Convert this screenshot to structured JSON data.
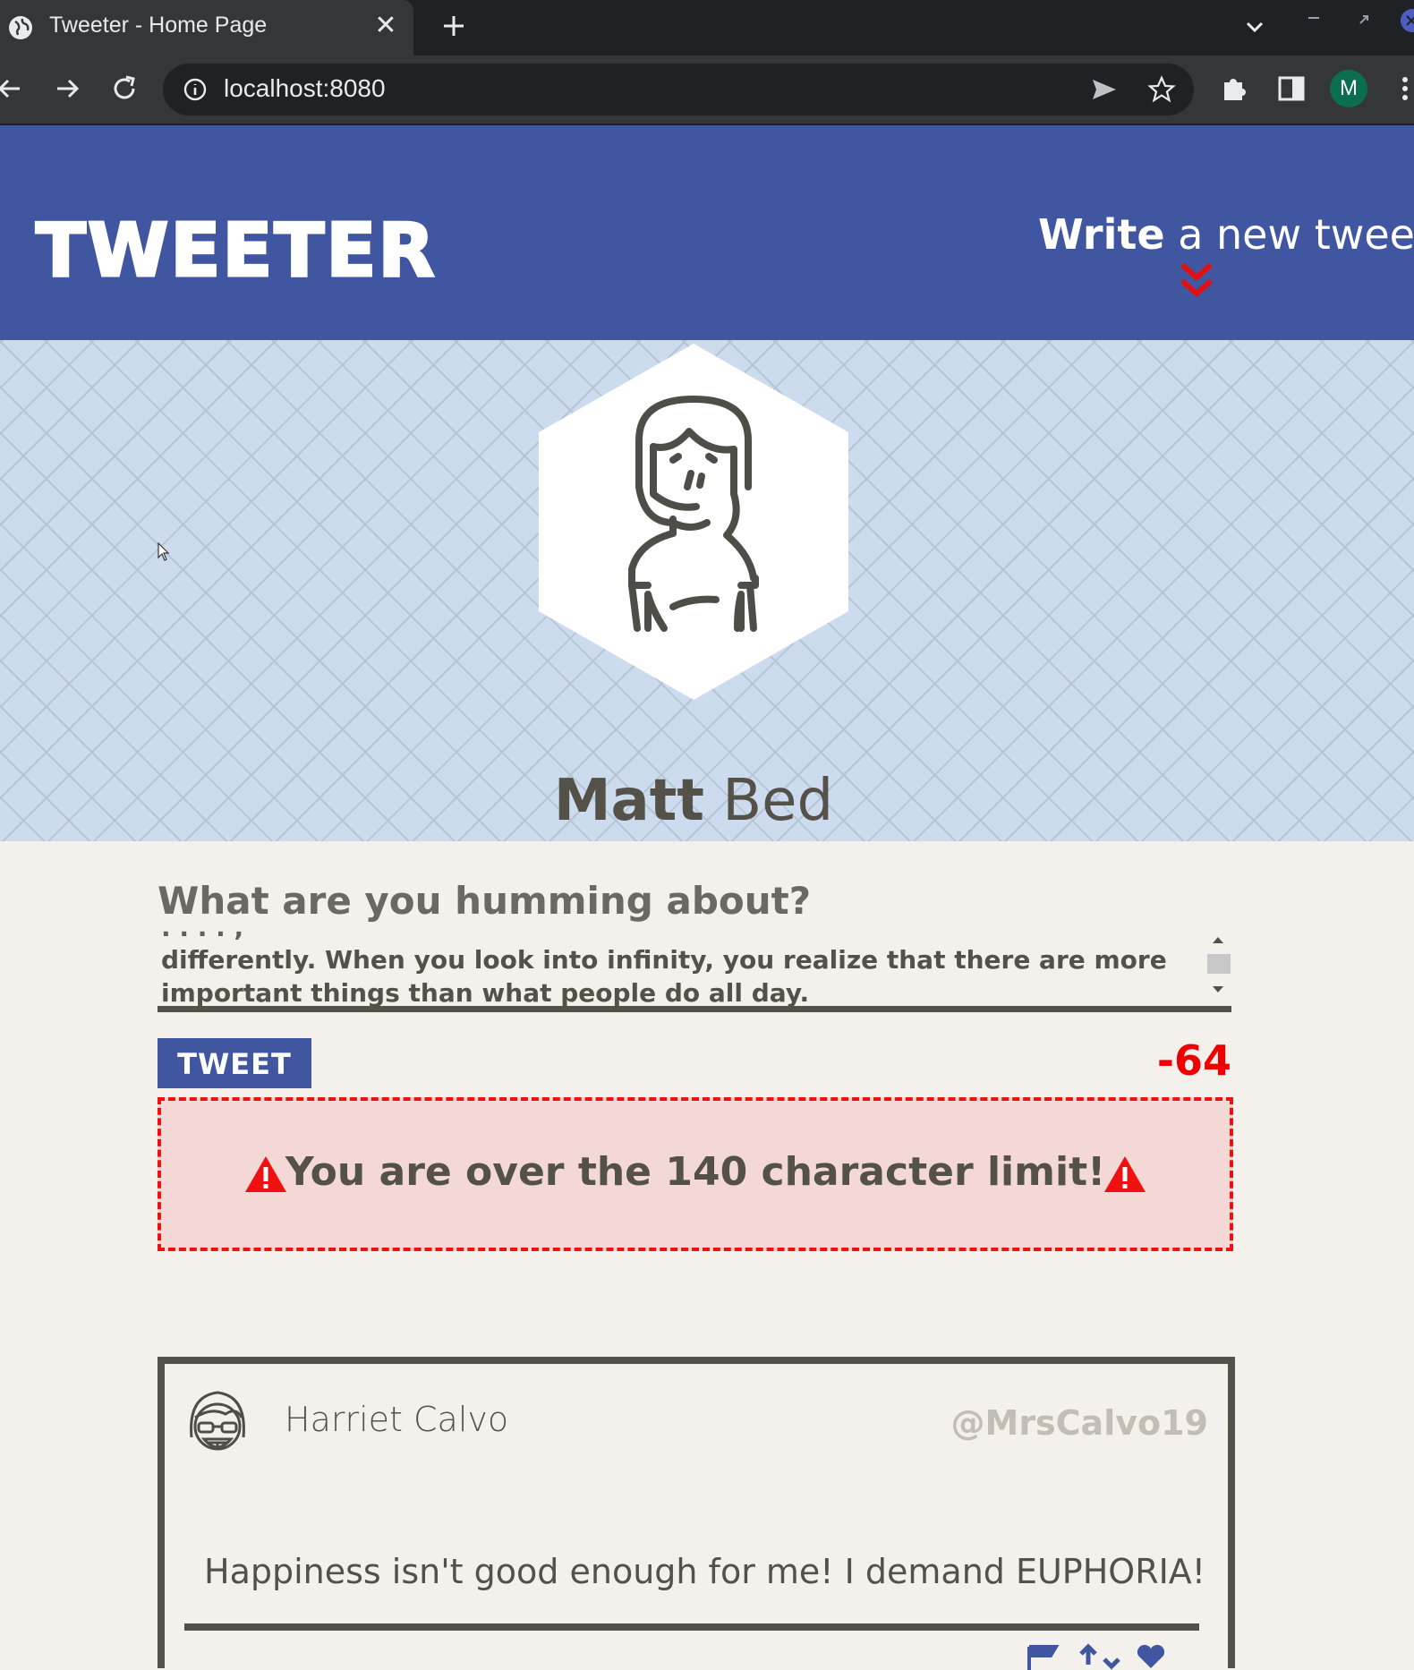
{
  "browser": {
    "tab_title": "Tweeter - Home Page",
    "address": "localhost:8080",
    "profile_initial": "M"
  },
  "header": {
    "logo": "TWEETER",
    "write_strong": "Write",
    "write_rest": " a new tweet"
  },
  "profile": {
    "first_name": "Matt",
    "last_name": " Bed"
  },
  "compose": {
    "label": "What are you humming about?",
    "text": "differently. When you look into infinity, you realize that there are more important things than what people do all day.",
    "tweet_button": "TWEET",
    "counter": "-64",
    "error": "You are over the 140 character limit!"
  },
  "tweets": [
    {
      "name": "Harriet Calvo",
      "handle": "@MrsCalvo19",
      "body": "Happiness isn't good enough for me! I demand EUPHORIA!"
    }
  ],
  "colors": {
    "header_bg": "#4056a1",
    "banner_bg": "#ccdcee",
    "page_bg": "#f4f1ec",
    "error_red": "#ee0000",
    "text_dark": "#545149"
  }
}
